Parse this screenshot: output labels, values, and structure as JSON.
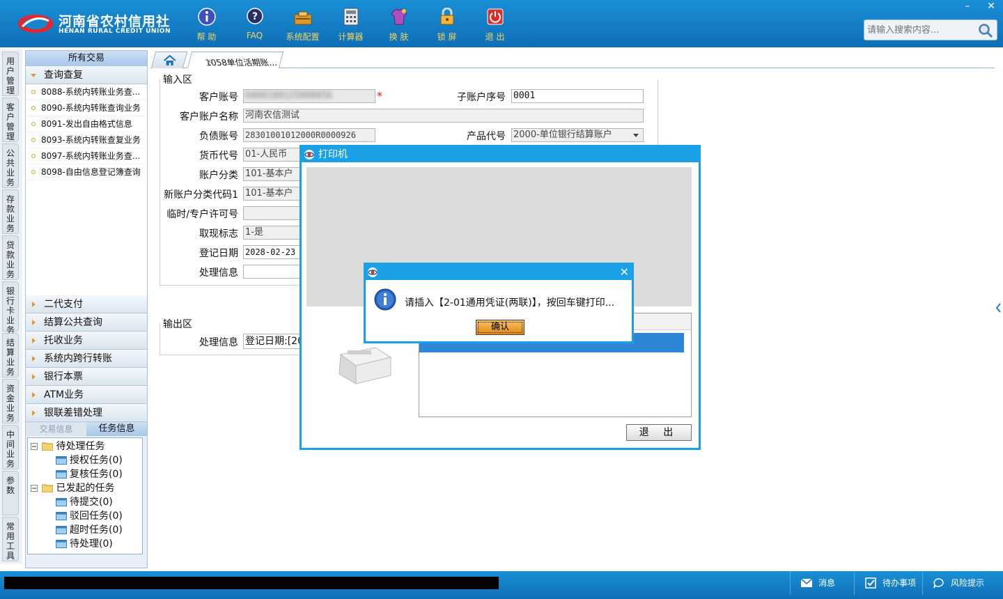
{
  "header": {
    "logo_cn": "河南省农村信用社",
    "logo_en": "HENAN RURAL CREDIT UNION",
    "toolbar": [
      {
        "label": "帮 助",
        "icon": "help-icon"
      },
      {
        "label": "FAQ",
        "icon": "faq-icon"
      },
      {
        "label": "系统配置",
        "icon": "settings-icon"
      },
      {
        "label": "计算器",
        "icon": "calculator-icon"
      },
      {
        "label": "换 肤",
        "icon": "skin-icon"
      },
      {
        "label": "锁 屏",
        "icon": "lock-icon"
      },
      {
        "label": "退 出",
        "icon": "power-icon"
      }
    ],
    "search_placeholder": "请输入搜索内容...",
    "minimize": "–",
    "close": "✕"
  },
  "vtabs": [
    "用户管理",
    "客户管理",
    "公共业务",
    "存款业务",
    "贷款业务",
    "银行卡业务",
    "结算业务",
    "资金业务",
    "中间业务",
    "参数",
    "常用工具"
  ],
  "nav": {
    "title": "所有交易",
    "open_group": "查询查复",
    "items": [
      "8088-系统内转账业务查...",
      "8090-系统内转账查询业务",
      "8091-发出自由格式信息",
      "8093-系统内转账查复业务",
      "8097-系统内转账业务查...",
      "8098-自由信息登记簿查询"
    ],
    "groups": [
      "二代支付",
      "结算公共查询",
      "托收业务",
      "系统内跨行转账",
      "银行本票",
      "ATM业务",
      "银联差错处理"
    ],
    "task_tabs": [
      "交易信息",
      "任务信息"
    ],
    "tree": [
      {
        "label": "待处理任务",
        "level": 0
      },
      {
        "label": "授权任务(0)",
        "level": 1
      },
      {
        "label": "复核任务(0)",
        "level": 1
      },
      {
        "label": "已发起的任务",
        "level": 0
      },
      {
        "label": "待提交(0)",
        "level": 1
      },
      {
        "label": "驳回任务(0)",
        "level": 1
      },
      {
        "label": "超时任务(0)",
        "level": 1
      },
      {
        "label": "待处理(0)",
        "level": 1
      }
    ]
  },
  "tabs": {
    "doc_tab": "1058单位活期账...",
    "doc_tab_close": "×"
  },
  "form": {
    "input_title": "输入区",
    "output_title": "输出区",
    "fields": {
      "cust_acct": {
        "label": "客户账号",
        "value": "6000100125000056"
      },
      "sub_seq": {
        "label": "子账户序号",
        "value": "0001"
      },
      "acct_name": {
        "label": "客户账户名称",
        "value": "河南农信测试"
      },
      "liab_acct": {
        "label": "负债账号",
        "value": "28301001012000R0000926"
      },
      "product": {
        "label": "产品代号",
        "value": "2000-单位银行结算账户"
      },
      "currency": {
        "label": "货币代号",
        "value": "01-人民币"
      },
      "acct_class": {
        "label": "账户分类",
        "value": "101-基本户"
      },
      "new_class": {
        "label": "新账户分类代码1",
        "value": "101-基本户"
      },
      "license": {
        "label": "临时/专户许可号",
        "value": ""
      },
      "cash_flag": {
        "label": "取现标志",
        "value": "1-是"
      },
      "reg_date": {
        "label": "登记日期",
        "value": "2028-02-23"
      },
      "proc_info": {
        "label": "处理信息",
        "value": ""
      }
    },
    "output": {
      "label": "处理信息",
      "value": "登记日期:[20"
    },
    "required_mark": "*"
  },
  "printer": {
    "title": "打印机",
    "exit": "退 出"
  },
  "alert": {
    "message": "请插入【2-01通用凭证(两联)】，按回车键打印...",
    "ok": "确认",
    "close": "✕"
  },
  "statusbar": {
    "items": [
      {
        "label": "消息",
        "icon": "mail-icon"
      },
      {
        "label": "待办事项",
        "icon": "checkbox-icon"
      },
      {
        "label": "风险提示",
        "icon": "chat-icon"
      }
    ]
  },
  "colors": {
    "accent": "#1aa0e6",
    "toolbar_label": "#f4d35e",
    "ok_button": "#e08a13"
  }
}
